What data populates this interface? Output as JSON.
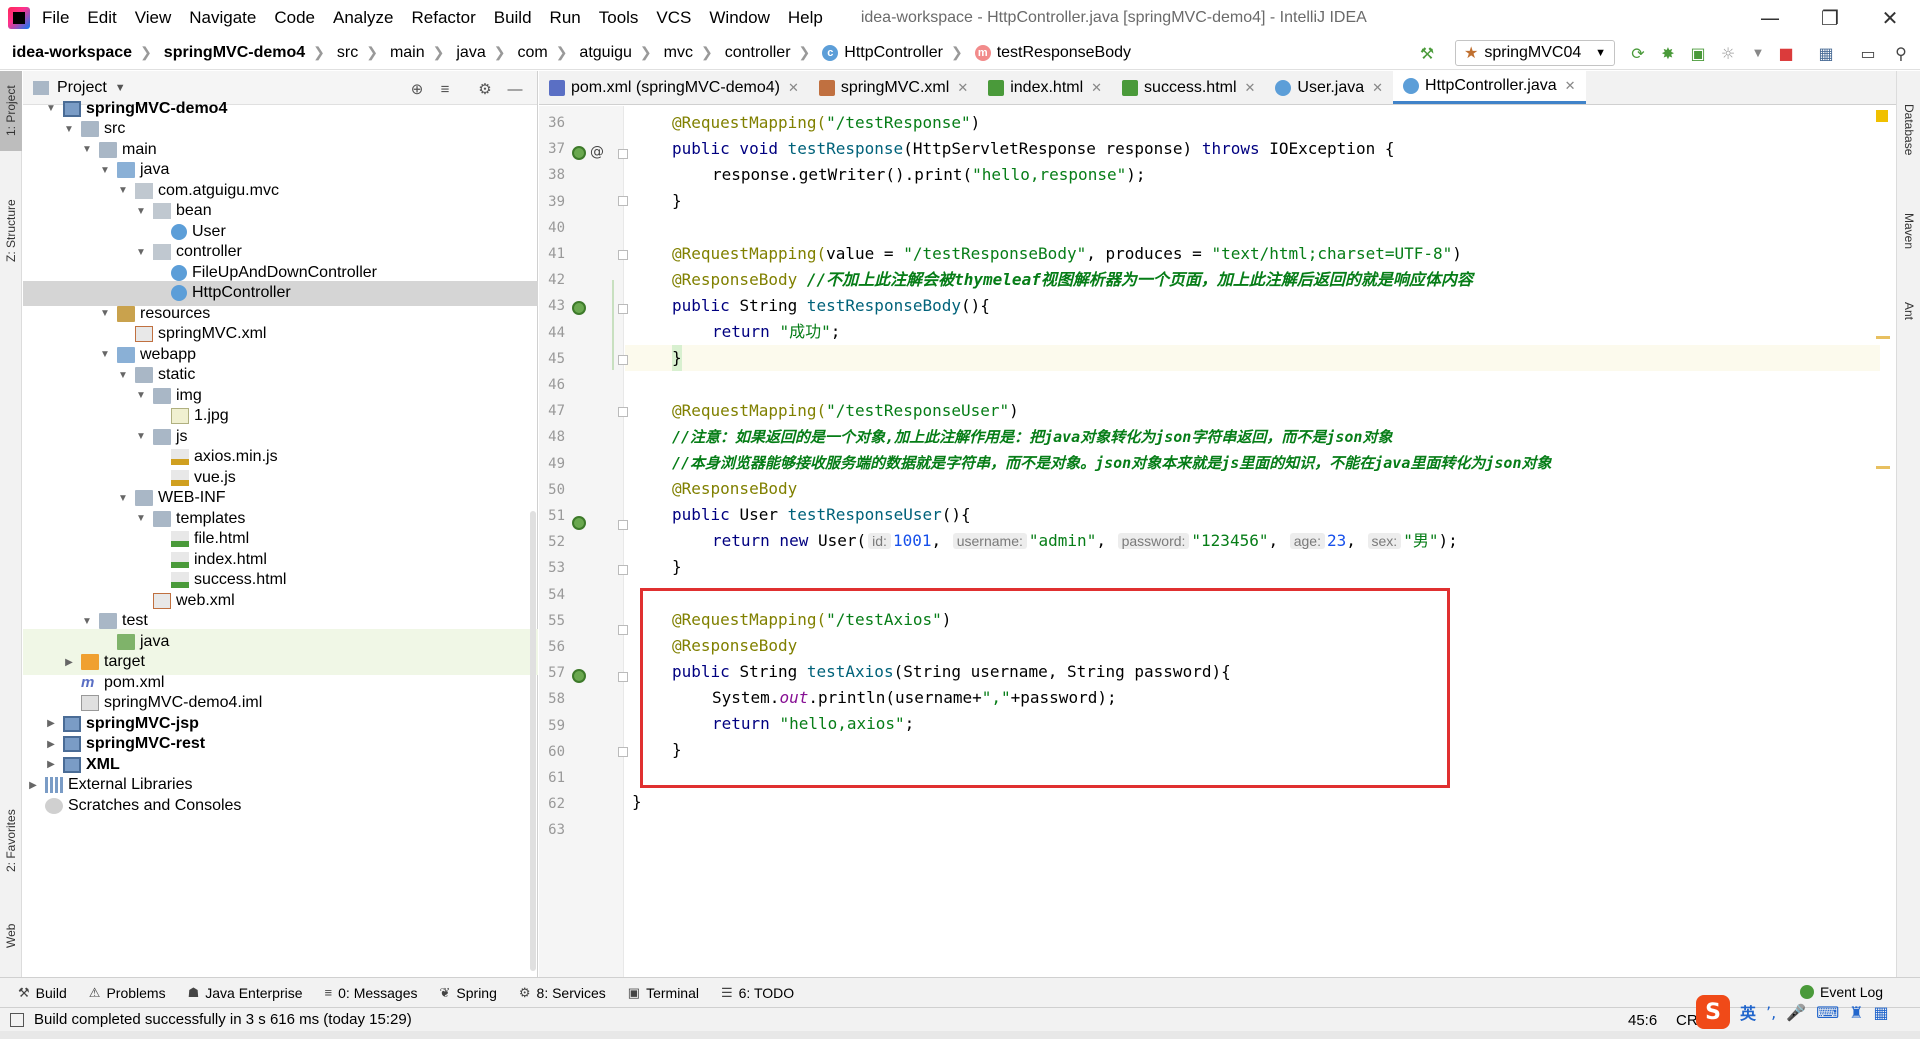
{
  "menu": [
    "File",
    "Edit",
    "View",
    "Navigate",
    "Code",
    "Analyze",
    "Refactor",
    "Build",
    "Run",
    "Tools",
    "VCS",
    "Window",
    "Help"
  ],
  "window_title": "idea-workspace - HttpController.java [springMVC-demo4] - IntelliJ IDEA",
  "breadcrumbs": [
    "idea-workspace",
    "springMVC-demo4",
    "src",
    "main",
    "java",
    "com",
    "atguigu",
    "mvc",
    "controller",
    "HttpController",
    "testResponseBody"
  ],
  "run_config": "springMVC04",
  "project_panel": {
    "title": "Project",
    "tree": [
      {
        "label": "springMVC-demo4",
        "depth": 1,
        "arrow": "down",
        "icon": "module",
        "bold": true
      },
      {
        "label": "src",
        "depth": 2,
        "arrow": "down",
        "icon": "folder"
      },
      {
        "label": "main",
        "depth": 3,
        "arrow": "down",
        "icon": "folder"
      },
      {
        "label": "java",
        "depth": 4,
        "arrow": "down",
        "icon": "folder src"
      },
      {
        "label": "com.atguigu.mvc",
        "depth": 5,
        "arrow": "down",
        "icon": "pkg"
      },
      {
        "label": "bean",
        "depth": 6,
        "arrow": "down",
        "icon": "pkg"
      },
      {
        "label": "User",
        "depth": 7,
        "arrow": "",
        "icon": "cls"
      },
      {
        "label": "controller",
        "depth": 6,
        "arrow": "down",
        "icon": "pkg"
      },
      {
        "label": "FileUpAndDownController",
        "depth": 7,
        "arrow": "",
        "icon": "cls"
      },
      {
        "label": "HttpController",
        "depth": 7,
        "arrow": "",
        "icon": "cls",
        "selected": true
      },
      {
        "label": "resources",
        "depth": 4,
        "arrow": "down",
        "icon": "folder res"
      },
      {
        "label": "springMVC.xml",
        "depth": 5,
        "arrow": "",
        "icon": "xml"
      },
      {
        "label": "webapp",
        "depth": 4,
        "arrow": "down",
        "icon": "folder src"
      },
      {
        "label": "static",
        "depth": 5,
        "arrow": "down",
        "icon": "folder"
      },
      {
        "label": "img",
        "depth": 6,
        "arrow": "down",
        "icon": "folder"
      },
      {
        "label": "1.jpg",
        "depth": 7,
        "arrow": "",
        "icon": "img"
      },
      {
        "label": "js",
        "depth": 6,
        "arrow": "down",
        "icon": "folder"
      },
      {
        "label": "axios.min.js",
        "depth": 7,
        "arrow": "",
        "icon": "js"
      },
      {
        "label": "vue.js",
        "depth": 7,
        "arrow": "",
        "icon": "js"
      },
      {
        "label": "WEB-INF",
        "depth": 5,
        "arrow": "down",
        "icon": "folder"
      },
      {
        "label": "templates",
        "depth": 6,
        "arrow": "down",
        "icon": "folder"
      },
      {
        "label": "file.html",
        "depth": 7,
        "arrow": "",
        "icon": "html"
      },
      {
        "label": "index.html",
        "depth": 7,
        "arrow": "",
        "icon": "html"
      },
      {
        "label": "success.html",
        "depth": 7,
        "arrow": "",
        "icon": "html"
      },
      {
        "label": "web.xml",
        "depth": 6,
        "arrow": "",
        "icon": "xml"
      },
      {
        "label": "test",
        "depth": 3,
        "arrow": "down",
        "icon": "folder"
      },
      {
        "label": "java",
        "depth": 4,
        "arrow": "",
        "icon": "folder test",
        "highlight": true
      },
      {
        "label": "target",
        "depth": 2,
        "arrow": "right",
        "icon": "folder target",
        "highlight": true
      },
      {
        "label": "pom.xml",
        "depth": 2,
        "arrow": "",
        "icon": "mvn"
      },
      {
        "label": "springMVC-demo4.iml",
        "depth": 2,
        "arrow": "",
        "icon": "iml"
      },
      {
        "label": "springMVC-jsp",
        "depth": 1,
        "arrow": "right",
        "icon": "module",
        "bold": true
      },
      {
        "label": "springMVC-rest",
        "depth": 1,
        "arrow": "right",
        "icon": "module",
        "bold": true
      },
      {
        "label": "XML",
        "depth": 1,
        "arrow": "right",
        "icon": "module",
        "bold": true
      },
      {
        "label": "External Libraries",
        "depth": 0,
        "arrow": "right",
        "icon": "lib"
      },
      {
        "label": "Scratches and Consoles",
        "depth": 0,
        "arrow": "",
        "icon": "scratch"
      }
    ]
  },
  "editor_tabs": [
    {
      "label": "pom.xml (springMVC-demo4)",
      "icon": "mvn"
    },
    {
      "label": "springMVC.xml",
      "icon": "xml"
    },
    {
      "label": "index.html",
      "icon": "html"
    },
    {
      "label": "success.html",
      "icon": "html"
    },
    {
      "label": "User.java",
      "icon": "cls"
    },
    {
      "label": "HttpController.java",
      "icon": "cls",
      "active": true
    }
  ],
  "code": {
    "line_numbers": [
      "36",
      "37",
      "38",
      "39",
      "40",
      "41",
      "42",
      "43",
      "44",
      "45",
      "46",
      "47",
      "48",
      "49",
      "50",
      "51",
      "52",
      "53",
      "54",
      "55",
      "56",
      "57",
      "58",
      "59",
      "60",
      "61",
      "62",
      "63"
    ],
    "l36_ann": "@RequestMapping(",
    "l36_str": "\"/testResponse\"",
    "l36_end": ")",
    "l37_a": "public void ",
    "l37_m": "testResponse",
    "l37_b": "(HttpServletResponse response) ",
    "l37_c": "throws",
    "l37_d": " IOException {",
    "l38_a": "response.getWriter().print(",
    "l38_s": "\"hello,response\"",
    "l38_b": ");",
    "l39": "}",
    "l41_a": "@RequestMapping(",
    "l41_b": "value = ",
    "l41_s1": "\"/testResponseBody\"",
    "l41_c": ", produces = ",
    "l41_s2": "\"text/html;charset=UTF-8\"",
    "l41_d": ")",
    "l42_a": "@ResponseBody",
    "l42_c": " //不加上此注解会被thymeleaf视图解析器为一个页面，加上此注解后返回的就是响应体内容",
    "l43_a": "public ",
    "l43_b": "String ",
    "l43_m": "testResponseBody",
    "l43_c": "(){",
    "l44_a": "return ",
    "l44_s": "\"成功\"",
    "l44_b": ";",
    "l45": "}",
    "l47_a": "@RequestMapping(",
    "l47_s": "\"/testResponseUser\"",
    "l47_b": ")",
    "l48": "//注意：如果返回的是一个对象,加上此注解作用是：把java对象转化为json字符串返回，而不是json对象",
    "l49": "//本身浏览器能够接收服务端的数据就是字符串，而不是对象。json对象本来就是js里面的知识，不能在java里面转化为json对象",
    "l50": "@ResponseBody",
    "l51_a": "public ",
    "l51_b": "User ",
    "l51_m": "testResponseUser",
    "l51_c": "(){",
    "l52_a": "return new ",
    "l52_b": "User(",
    "l52_h1": "id:",
    "l52_v1": "1001",
    "l52_h2": "username:",
    "l52_v2": "\"admin\"",
    "l52_h3": "password:",
    "l52_v3": "\"123456\"",
    "l52_h4": "age:",
    "l52_v4": "23",
    "l52_h5": "sex:",
    "l52_v5": "\"男\"",
    "l52_end": ");",
    "l53": "}",
    "l55_a": "@RequestMapping(",
    "l55_s": "\"/testAxios\"",
    "l55_b": ")",
    "l56": "@ResponseBody",
    "l57_a": "public ",
    "l57_b": "String ",
    "l57_m": "testAxios",
    "l57_c": "(String username, String password){",
    "l58_a": "System.",
    "l58_f": "out",
    "l58_b": ".println(username+",
    "l58_s": "\",\"",
    "l58_c": "+password);",
    "l59_a": "return ",
    "l59_s": "\"hello,axios\"",
    "l59_b": ";",
    "l60": "}",
    "l62": "}"
  },
  "left_strip": [
    "1: Project",
    "Z: Structure",
    "2: Favorites",
    "Web"
  ],
  "right_strip": [
    "Database",
    "Maven",
    "Ant"
  ],
  "bottom_tools": [
    {
      "label": "Build",
      "icon": "hammer-icon"
    },
    {
      "label": "Problems",
      "icon": "warning-icon"
    },
    {
      "label": "Java Enterprise",
      "icon": "enterprise-icon"
    },
    {
      "label": "0: Messages",
      "icon": "messages-icon"
    },
    {
      "label": "Spring",
      "icon": "spring-icon"
    },
    {
      "label": "8: Services",
      "icon": "services-icon"
    },
    {
      "label": "Terminal",
      "icon": "terminal-icon"
    },
    {
      "label": "6: TODO",
      "icon": "todo-icon"
    }
  ],
  "event_log": "Event Log",
  "status": {
    "message": "Build completed successfully in 3 s 616 ms (today 15:29)",
    "caret": "45:6",
    "line_sep": "CRL"
  },
  "ime": {
    "logo": "S",
    "lang": "英"
  }
}
